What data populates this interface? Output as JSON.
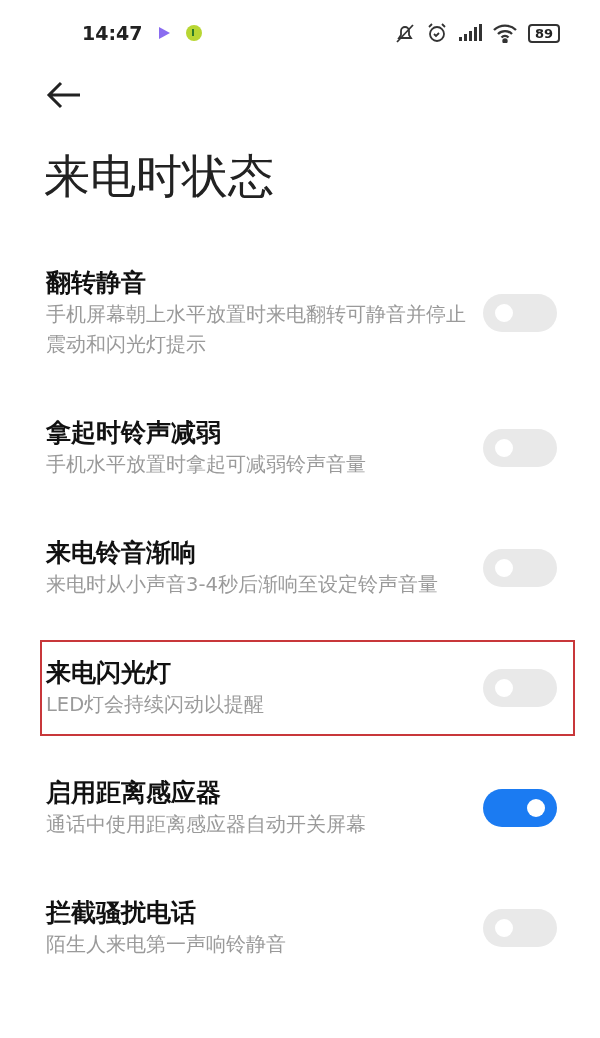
{
  "status_bar": {
    "time": "14:47",
    "battery": "89"
  },
  "title": "来电时状态",
  "settings": [
    {
      "title": "翻转静音",
      "description": "手机屏幕朝上水平放置时来电翻转可静音并停止震动和闪光灯提示",
      "on": false,
      "highlighted": false
    },
    {
      "title": "拿起时铃声减弱",
      "description": "手机水平放置时拿起可减弱铃声音量",
      "on": false,
      "highlighted": false
    },
    {
      "title": "来电铃音渐响",
      "description": "来电时从小声音3-4秒后渐响至设定铃声音量",
      "on": false,
      "highlighted": false
    },
    {
      "title": "来电闪光灯",
      "description": "LED灯会持续闪动以提醒",
      "on": false,
      "highlighted": true
    },
    {
      "title": "启用距离感应器",
      "description": "通话中使用距离感应器自动开关屏幕",
      "on": true,
      "highlighted": false
    },
    {
      "title": "拦截骚扰电话",
      "description": "陌生人来电第一声响铃静音",
      "on": false,
      "highlighted": false
    }
  ]
}
